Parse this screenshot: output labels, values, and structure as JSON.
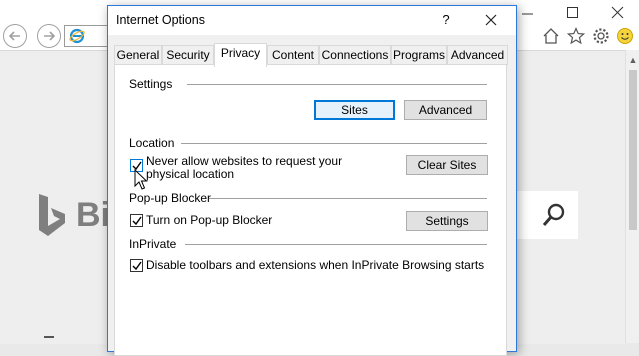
{
  "dialog": {
    "title": "Internet Options",
    "help_label": "?",
    "tabs": [
      {
        "label": "General"
      },
      {
        "label": "Security"
      },
      {
        "label": "Privacy",
        "active": true
      },
      {
        "label": "Content"
      },
      {
        "label": "Connections"
      },
      {
        "label": "Programs"
      },
      {
        "label": "Advanced"
      }
    ],
    "settings": {
      "label": "Settings",
      "sites_button": "Sites",
      "advanced_button": "Advanced"
    },
    "location": {
      "label": "Location",
      "checkbox_line1": "Never allow websites to request your",
      "checkbox_line2": "physical location",
      "checked": true,
      "clear_sites_button": "Clear Sites"
    },
    "popup_blocker": {
      "label": "Pop-up Blocker",
      "checkbox_label": "Turn on Pop-up Blocker",
      "checked": true,
      "settings_button": "Settings"
    },
    "inprivate": {
      "label": "InPrivate",
      "checkbox_label": "Disable toolbars and extensions when InPrivate Browsing starts",
      "checked": true
    }
  },
  "browser": {
    "bing_text": "Bi",
    "toolbar_icons": [
      "back-icon",
      "forward-icon",
      "ie-logo-icon",
      "home-icon",
      "favorites-star-icon",
      "gear-icon",
      "smiley-feedback-icon"
    ],
    "window_controls": [
      "minimize-icon",
      "maximize-icon",
      "close-icon"
    ]
  },
  "colors": {
    "accent": "#0078d7",
    "dialog_border": "#2b79d8",
    "bing_gray": "#7f7f7f"
  }
}
